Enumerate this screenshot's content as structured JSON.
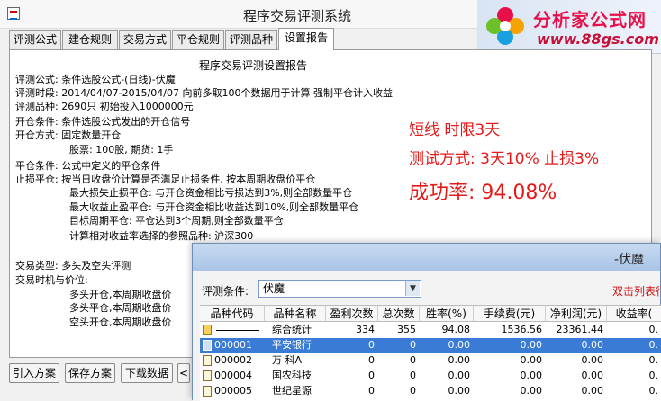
{
  "window": {
    "title": "程序交易评测系统"
  },
  "logo": {
    "title": "分析家公式网",
    "url": "www.88gs.com"
  },
  "tabs": [
    "评测公式",
    "建仓规则",
    "交易方式",
    "平仓规则",
    "评测品种",
    "设置报告"
  ],
  "report": {
    "title": "程序交易评测设置报告",
    "lines": [
      "评测公式:  条件选股公式-(日线)-伏魔",
      "评测时段:  2014/04/07-2015/04/07 向前多取100个数据用于计算 强制平仓计入收益",
      "评测品种:  2690只  初始投入1000000元",
      "开仓条件:  条件选股公式发出的开仓信号",
      "开仓方式:  固定数量开仓",
      "股票: 100股, 期货: 1手",
      "平仓条件:  公式中定义的平仓条件",
      "止损平仓:  按当日收盘价计算是否满足止损条件, 按本周期收盘价平仓",
      "最大损失止损平仓: 与开仓资金相比亏损达到3%,则全部数量平仓",
      "最大收益止盈平仓: 与开仓资金相比收益达到10%,则全部数量平仓",
      "目标周期平仓:  平仓达到3个周期,则全部数量平仓",
      "计算相对收益率选择的参照品种: 沪深300",
      "交易类型:  多头及空头评测",
      "交易时机与价位:",
      "多头开仓,本周期收盘价",
      "多头平仓,本周期收盘价",
      "空头开仓,本周期收盘价"
    ],
    "notes": [
      "短线  时限3天",
      "测试方式: 3天10%  止损3%",
      "成功率: 94.08%"
    ]
  },
  "buttons": [
    "引入方案",
    "保存方案",
    "下载数据",
    "<"
  ],
  "popup": {
    "title": "-伏魔",
    "condition_label": "评测条件:",
    "condition_value": "伏魔",
    "hint": "双击列表行",
    "columns": [
      "品种代码",
      "品种名称",
      "盈利次数",
      "总次数",
      "胜率(%)",
      "手续费(元)",
      "净利润(元)",
      "收益率("
    ],
    "rows": [
      {
        "code": "",
        "name": "综合统计",
        "win": "334",
        "total": "355",
        "rate": "94.08",
        "fee": "1536.56",
        "profit": "23361.44",
        "ret": "0."
      },
      {
        "code": "000001",
        "name": "平安银行",
        "win": "0",
        "total": "0",
        "rate": "0.00",
        "fee": "0.00",
        "profit": "0.00",
        "ret": "0."
      },
      {
        "code": "000002",
        "name": "万  科A",
        "win": "0",
        "total": "0",
        "rate": "0.00",
        "fee": "0.00",
        "profit": "0.00",
        "ret": "0."
      },
      {
        "code": "000004",
        "name": "国农科技",
        "win": "0",
        "total": "0",
        "rate": "0.00",
        "fee": "0.00",
        "profit": "0.00",
        "ret": "0."
      },
      {
        "code": "000005",
        "name": "世纪星源",
        "win": "0",
        "total": "0",
        "rate": "0.00",
        "fee": "0.00",
        "profit": "0.00",
        "ret": "0."
      }
    ]
  },
  "colors": {
    "accent_red": "#e61919",
    "selection": "#3a7bd5"
  }
}
